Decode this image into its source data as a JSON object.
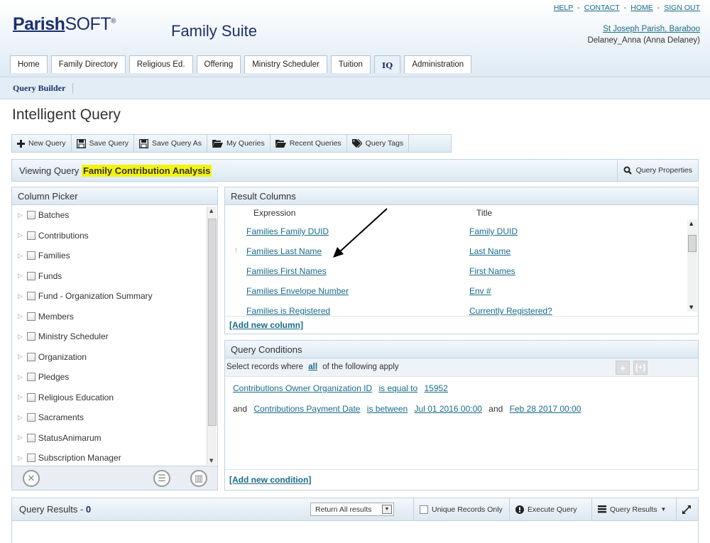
{
  "header": {
    "logo_part1": "Parish",
    "logo_part2": "SOFT",
    "logo_tm": "®",
    "suite_title": "Family Suite",
    "top_links": [
      "HELP",
      "CONTACT",
      "HOME",
      "SIGN OUT"
    ],
    "link_separator": "-",
    "parish_name": "St Joseph Parish, Baraboo",
    "user_name": "Delaney_Anna (Anna Delaney)"
  },
  "tabs": [
    {
      "label": "Home"
    },
    {
      "label": "Family Directory"
    },
    {
      "label": "Religious Ed."
    },
    {
      "label": "Offering"
    },
    {
      "label": "Ministry Scheduler"
    },
    {
      "label": "Tuition"
    },
    {
      "label": "IQ",
      "active": true
    },
    {
      "label": "Administration"
    }
  ],
  "subnav": {
    "query_builder": "Query Builder"
  },
  "page_title": "Intelligent Query",
  "toolbar": {
    "new_query": "New Query",
    "save_query": "Save Query",
    "save_query_as": "Save Query As",
    "my_queries": "My Queries",
    "recent_queries": "Recent Queries",
    "query_tags": "Query Tags"
  },
  "viewing": {
    "prefix": "Viewing Query",
    "query_name": "Family Contribution Analysis",
    "properties_button": "Query Properties"
  },
  "column_picker": {
    "title": "Column Picker",
    "items": [
      "Batches",
      "Contributions",
      "Families",
      "Funds",
      "Fund - Organization Summary",
      "Members",
      "Ministry Scheduler",
      "Organization",
      "Pledges",
      "Religious Education",
      "Sacraments",
      "StatusAnimarum",
      "Subscription Manager"
    ]
  },
  "result_columns": {
    "title": "Result Columns",
    "header_expression": "Expression",
    "header_title": "Title",
    "rows": [
      {
        "expression": "Families Family DUID",
        "title": "Family DUID"
      },
      {
        "expression": "Families Last Name",
        "title": "Last Name"
      },
      {
        "expression": "Families First Names",
        "title": "First Names"
      },
      {
        "expression": "Families Envelope Number",
        "title": "Env #"
      },
      {
        "expression": "Families is Registered",
        "title": "Currently Registered?"
      }
    ],
    "add_label": "[Add new column]"
  },
  "conditions": {
    "title": "Query Conditions",
    "select_prefix": "Select records where",
    "select_all": "all",
    "select_suffix": "of the following apply",
    "row1": {
      "field": "Contributions Owner Organization ID",
      "op": "is equal to",
      "value": "15952"
    },
    "row2": {
      "joiner": "and",
      "field": "Contributions Payment Date",
      "op": "is between",
      "value1": "Jul 01 2016 00:00",
      "and_word": "and",
      "value2": "Feb 28 2017 00:00"
    },
    "add_label": "[Add new condition]"
  },
  "query_results": {
    "title_prefix": "Query Results - ",
    "count": "0",
    "return_select": "Return All results",
    "unique_label": "Unique Records Only",
    "execute_label": "Execute Query",
    "results_label": "Query Results"
  },
  "colors": {
    "accent": "#1d2f6b",
    "link": "#1a6b8a",
    "highlight": "#f3f30f"
  }
}
